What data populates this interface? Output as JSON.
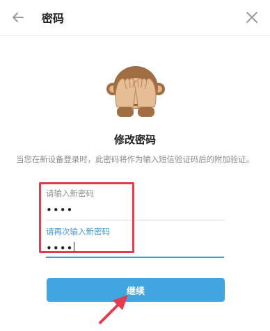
{
  "header": {
    "title": "密码"
  },
  "main": {
    "heading": "修改密码",
    "description": "当您在新设备登录时，此密码将作为输入短信验证码后的附加验证。",
    "fields": [
      {
        "label": "请输入新密码",
        "value": "••••",
        "state": "filled"
      },
      {
        "label": "请再次输入新密码",
        "value": "••••",
        "state": "focused"
      }
    ],
    "continue_label": "继续"
  },
  "icons": {
    "back": "arrow-left-icon",
    "close": "close-icon",
    "illustration": "see-no-evil-monkey-icon",
    "annotation": "red-pointer-arrow"
  },
  "colors": {
    "accent": "#40a6e0",
    "focus_label": "#3d9ad6",
    "annotation": "#e23b4d"
  }
}
